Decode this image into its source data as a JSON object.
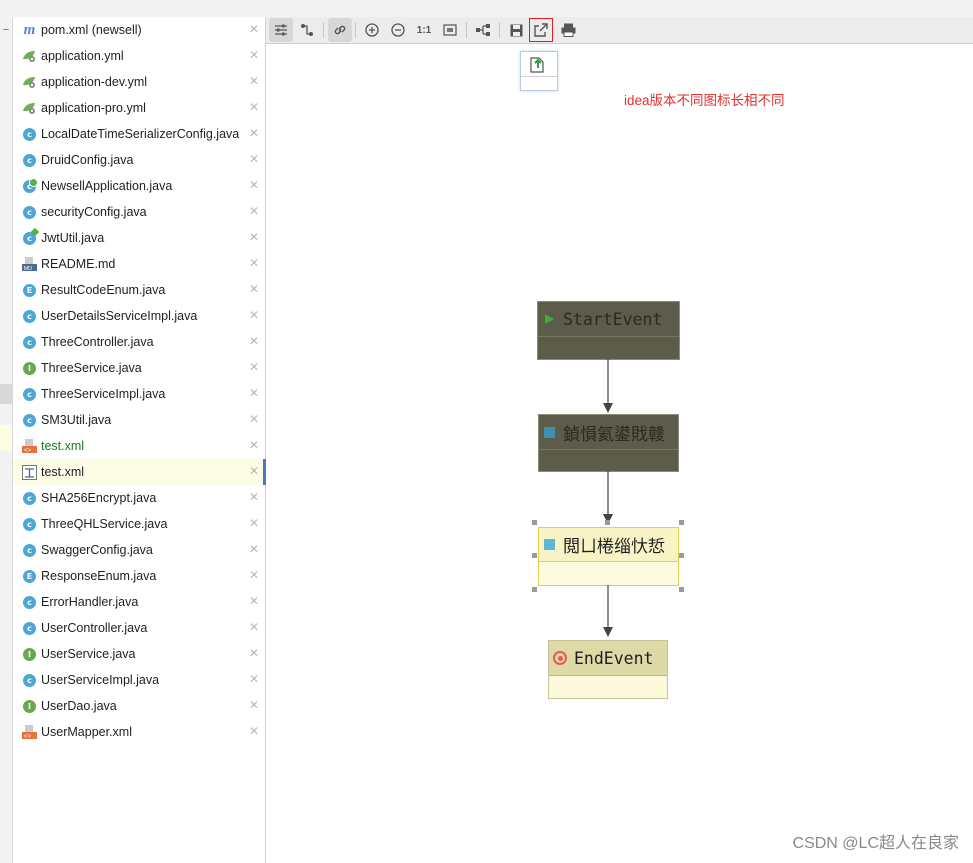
{
  "files": [
    {
      "name": "pom.xml (newsell)",
      "icon": "maven-icon",
      "selected": false
    },
    {
      "name": "application.yml",
      "icon": "spring-config-icon",
      "selected": false
    },
    {
      "name": "application-dev.yml",
      "icon": "spring-config-icon",
      "selected": false
    },
    {
      "name": "application-pro.yml",
      "icon": "spring-config-icon",
      "selected": false
    },
    {
      "name": "LocalDateTimeSerializerConfig.java",
      "icon": "class-icon",
      "selected": false
    },
    {
      "name": "DruidConfig.java",
      "icon": "class-icon",
      "selected": false
    },
    {
      "name": "NewsellApplication.java",
      "icon": "spring-app-class-icon",
      "selected": false
    },
    {
      "name": "securityConfig.java",
      "icon": "class-icon",
      "selected": false
    },
    {
      "name": "JwtUtil.java",
      "icon": "spring-class-icon",
      "selected": false
    },
    {
      "name": "README.md",
      "icon": "markdown-icon",
      "selected": false
    },
    {
      "name": "ResultCodeEnum.java",
      "icon": "enum-icon",
      "selected": false
    },
    {
      "name": "UserDetailsServiceImpl.java",
      "icon": "class-icon",
      "selected": false
    },
    {
      "name": "ThreeController.java",
      "icon": "class-icon",
      "selected": false
    },
    {
      "name": "ThreeService.java",
      "icon": "interface-icon",
      "selected": false
    },
    {
      "name": "ThreeServiceImpl.java",
      "icon": "class-icon",
      "selected": false
    },
    {
      "name": "SM3Util.java",
      "icon": "class-icon",
      "selected": false
    },
    {
      "name": "test.xml",
      "icon": "xml-icon",
      "selected": false,
      "modified": true
    },
    {
      "name": "test.xml",
      "icon": "bpmn-diagram-icon",
      "selected": true
    },
    {
      "name": "SHA256Encrypt.java",
      "icon": "class-icon",
      "selected": false
    },
    {
      "name": "ThreeQHLService.java",
      "icon": "class-icon",
      "selected": false
    },
    {
      "name": "SwaggerConfig.java",
      "icon": "class-icon",
      "selected": false
    },
    {
      "name": "ResponseEnum.java",
      "icon": "enum-icon",
      "selected": false
    },
    {
      "name": "ErrorHandler.java",
      "icon": "class-icon",
      "selected": false
    },
    {
      "name": "UserController.java",
      "icon": "class-icon",
      "selected": false
    },
    {
      "name": "UserService.java",
      "icon": "interface-icon",
      "selected": false
    },
    {
      "name": "UserServiceImpl.java",
      "icon": "class-icon",
      "selected": false
    },
    {
      "name": "UserDao.java",
      "icon": "interface-icon",
      "selected": false
    },
    {
      "name": "UserMapper.xml",
      "icon": "xml-icon",
      "selected": false
    }
  ],
  "toolbar": [
    {
      "icon": "properties-icon",
      "active": true
    },
    {
      "icon": "edge-route-icon",
      "active": false
    },
    {
      "icon": "link-icon",
      "active": true
    },
    {
      "icon": "zoom-in-icon",
      "active": false
    },
    {
      "icon": "zoom-out-icon",
      "active": false
    },
    {
      "icon": "actual-size-icon",
      "label": "1:1",
      "active": false
    },
    {
      "icon": "fit-content-icon",
      "active": false
    },
    {
      "icon": "layout-icon",
      "active": false
    },
    {
      "icon": "save-icon",
      "active": false
    },
    {
      "icon": "export-icon",
      "active": false,
      "highlighted": true
    },
    {
      "icon": "print-icon",
      "active": false
    }
  ],
  "annotation": "idea版本不同图标长相不同",
  "diagram": {
    "nodes": [
      {
        "label": "StartEvent",
        "kind": "start-event"
      },
      {
        "label": "鍞愪氦鍙戝竷",
        "kind": "user-task"
      },
      {
        "label": "閲ㄩ棬缁忕悊",
        "kind": "user-task"
      },
      {
        "label": "EndEvent",
        "kind": "end-event"
      }
    ]
  },
  "colors": {
    "dark_node": "#5d5b4a",
    "selected_node": "#f7f3c5",
    "end_node": "#fbf9da",
    "note_red": "#e2302a",
    "selection_blue": "#4a78c2"
  },
  "watermark": "CSDN @LC超人在良家"
}
